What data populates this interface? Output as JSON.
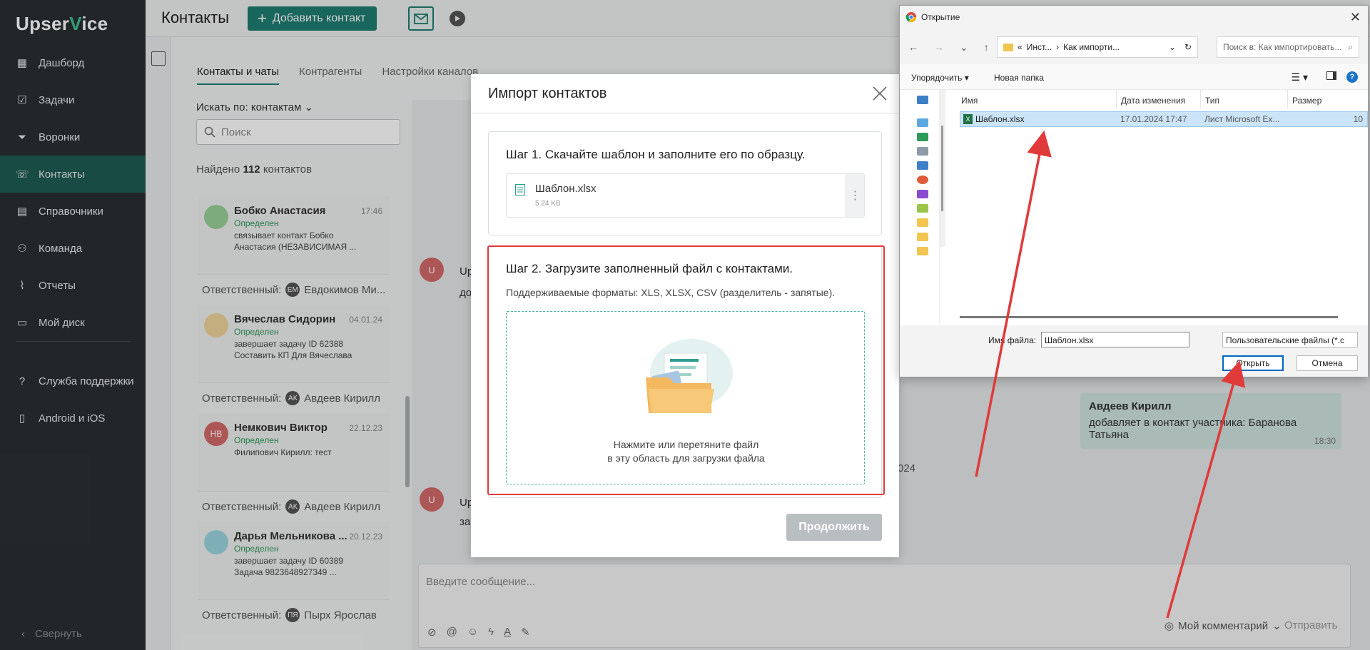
{
  "app": {
    "logo_a": "Upser",
    "logo_v": "V",
    "logo_b": "ice"
  },
  "sidebar": {
    "items": [
      {
        "label": "Дашборд",
        "icon": "dashboard-icon"
      },
      {
        "label": "Задачи",
        "icon": "tasks-icon"
      },
      {
        "label": "Воронки",
        "icon": "funnel-icon"
      },
      {
        "label": "Контакты",
        "icon": "contacts-icon",
        "active": true
      },
      {
        "label": "Справочники",
        "icon": "book-icon"
      },
      {
        "label": "Команда",
        "icon": "team-icon"
      },
      {
        "label": "Отчеты",
        "icon": "chart-icon"
      },
      {
        "label": "Мой диск",
        "icon": "folder-icon"
      }
    ],
    "items_bottom": [
      {
        "label": "Служба поддержки",
        "icon": "help-icon"
      },
      {
        "label": "Android и iOS",
        "icon": "phone-icon"
      }
    ],
    "collapse_label": "Свернуть"
  },
  "header": {
    "title": "Контакты",
    "add_contact": "Добавить контакт"
  },
  "contacts_panel": {
    "tabs": [
      "Контакты и чаты",
      "Контрагенты",
      "Настройки каналов"
    ],
    "search_by": "Искать по: контактам",
    "search_placeholder": "Поиск",
    "found_prefix": "Найдено",
    "found_count": "112",
    "found_suffix": "контактов",
    "contacts": [
      {
        "name": "Бобко Анастасия",
        "time": "17:46",
        "status": "Определен",
        "text": "связывает контакт Бобко Анастасия (НЕЗАВИСИМАЯ ...",
        "resp_label": "Ответственный:",
        "resp_initials": "ЕМ",
        "resp_name": "Евдокимов Ми...",
        "avatar_color": "#9ad19a"
      },
      {
        "name": "Вячеслав Сидорин",
        "time": "04.01.24",
        "status": "Определен",
        "text": "завершает задачу ID 62388 Составить КП Для Вячеслава",
        "resp_label": "Ответственный:",
        "resp_initials": "АК",
        "resp_name": "Авдеев Кирилл",
        "avatar_color": "#f0d39a"
      },
      {
        "name": "Немкович Виктор",
        "time": "22.12.23",
        "status": "Определен",
        "text": "Филипович Кирилл: тест",
        "resp_label": "Ответственный:",
        "resp_initials": "АК",
        "resp_name": "Авдеев Кирилл",
        "avatar_color": "#d46a6a",
        "avatar_initials": "НВ"
      },
      {
        "name": "Дарья Мельникова ...",
        "time": "20.12.23",
        "status": "Определен",
        "text": "завершает задачу ID 60389 Задача 9823648927349 ...",
        "resp_label": "Ответственный:",
        "resp_initials": "ПЯ",
        "resp_name": "Пырх Ярослав",
        "avatar_color": "#9ad6e0"
      }
    ]
  },
  "chat": {
    "avatar_letter": "U",
    "stub_1": "Up",
    "stub_2": "до",
    "stub_3": "Up",
    "stub_4": "за",
    "date_stub": "024",
    "bubble_name": "Авдеев Кирилл",
    "bubble_text": "добавляет в контакт участника: Баранова Татьяна",
    "bubble_time": "18:30",
    "input_placeholder": "Введите сообщение...",
    "my_comment": "Мой комментарий",
    "send": "Отправить"
  },
  "import_modal": {
    "title": "Импорт контактов",
    "step1_title": "Шаг 1. Скачайте шаблон и заполните его по образцу.",
    "file_name": "Шаблон.xlsx",
    "file_size": "5.24 KB",
    "step2_title": "Шаг 2. Загрузите заполненный файл с контактами.",
    "formats": "Поддерживаемые форматы: XLS, XLSX, CSV (разделитель - запятые).",
    "drop_line1": "Нажмите или перетяните файл",
    "drop_line2": "в эту область для загрузки файла",
    "continue": "Продолжить"
  },
  "file_dialog": {
    "title": "Открытие",
    "path_prefix": "«",
    "path_1": "Инст...",
    "path_sep": "›",
    "path_2": "Как импорти...",
    "search_placeholder": "Поиск в: Как импортировать...",
    "organize": "Упорядочить ▾",
    "new_folder": "Новая папка",
    "columns": [
      "Имя",
      "Дата изменения",
      "Тип",
      "Размер"
    ],
    "files": [
      {
        "name": "Шаблон.xlsx",
        "date": "17.01.2024 17:47",
        "type": "Лист Microsoft Ex...",
        "size": "10"
      }
    ],
    "filename_label": "Имя файла:",
    "filename_value": "Шаблон.xlsx",
    "filter": "Пользовательские файлы (*.c",
    "open": "Открыть",
    "cancel": "Отмена"
  },
  "colors": {
    "accent": "#1f7d72",
    "annotation": "#e03a3a",
    "sidebar": "#2a2f33"
  }
}
